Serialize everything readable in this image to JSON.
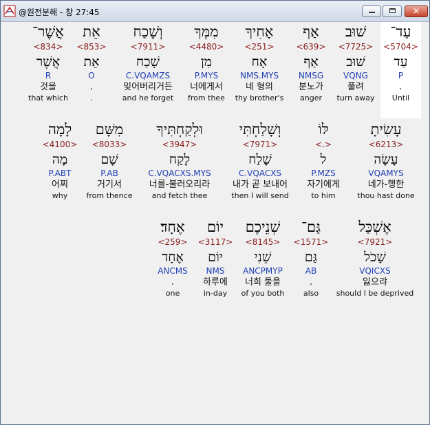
{
  "window": {
    "title": "@원전분해 - 창 27:45"
  },
  "rows": [
    [
      {
        "heb": "עַד־",
        "strong": "<5704>",
        "root": "עַד",
        "morph": "P",
        "kor": ".",
        "eng": "Until",
        "selected": true
      },
      {
        "heb": "שׁוּב",
        "strong": "<7725>",
        "root": "שׁוּב",
        "morph": "VQNG",
        "kor": "풀려",
        "eng": "turn away"
      },
      {
        "heb": "אַף",
        "strong": "<639>",
        "root": "אַף",
        "morph": "NMSG",
        "kor": "분노가",
        "eng": "anger"
      },
      {
        "heb": "אָחִיךָ",
        "strong": "<251>",
        "root": "אָח",
        "morph": "NMS.MYS",
        "kor": "네 형의",
        "eng": "thy brother's"
      },
      {
        "heb": "מִמְּךָ",
        "strong": "<4480>",
        "root": "מִן",
        "morph": "P.MYS",
        "kor": "너에게서",
        "eng": "from thee"
      },
      {
        "heb": "וְשָׁכַח",
        "strong": "<7911>",
        "root": "שָׁכַח",
        "morph": "C.VQAMZS",
        "kor": "잊어버리거든",
        "eng": "and he forget"
      },
      {
        "heb": "אֵת",
        "strong": "<853>",
        "root": "אֵת",
        "morph": "O",
        "kor": ".",
        "eng": "."
      },
      {
        "heb": "אֲשֶׁר־",
        "strong": "<834>",
        "root": "אֲשֶׁר",
        "morph": "R",
        "kor": "것을",
        "eng": "that which"
      }
    ],
    [
      {
        "heb": "עָשִׂיתָ",
        "strong": "<6213>",
        "root": "עָשָׂה",
        "morph": "VQAMYS",
        "kor": "네가-행한",
        "eng": "thou hast done"
      },
      {
        "heb": "לּוֹ",
        "strong": "<.>",
        "root": "ל",
        "morph": "P.MZS",
        "kor": "자기에게",
        "eng": "to him"
      },
      {
        "heb": "וְשָׁלַחְתִּי",
        "strong": "<7971>",
        "root": "שָׁלַח",
        "morph": "C.VQACXS",
        "kor": "내가 곧 보내어",
        "eng": "then I will send"
      },
      {
        "heb": "וּלְקַחְתִּיךָ",
        "strong": "<3947>",
        "root": "לָקַח",
        "morph": "C.VQACXS.MYS",
        "kor": "너를-불러오리라",
        "eng": "and fetch thee"
      },
      {
        "heb": "מִשָּׁם",
        "strong": "<8033>",
        "root": "שָׁם",
        "morph": "P.AB",
        "kor": "거기서",
        "eng": "from thence"
      },
      {
        "heb": "לָמָה",
        "strong": "<4100>",
        "root": "מָה",
        "morph": "P.ABT",
        "kor": "어찌",
        "eng": "why"
      }
    ],
    [
      {
        "heb": "אֶשְׁכַּל",
        "strong": "<7921>",
        "root": "שָׁכֹל",
        "morph": "VQICXS",
        "kor": "잃으랴",
        "eng": "should I be deprived"
      },
      {
        "heb": "גַּם־",
        "strong": "<1571>",
        "root": "גַּם",
        "morph": "AB",
        "kor": ".",
        "eng": "also"
      },
      {
        "heb": "שְׁנֵיכֶם",
        "strong": "<8145>",
        "root": "שֵׁנִי",
        "morph": "ANCPMYP",
        "kor": "너희 둘을",
        "eng": "of you both"
      },
      {
        "heb": "יוֹם",
        "strong": "<3117>",
        "root": "יוֹם",
        "morph": "NMS",
        "kor": "하루에",
        "eng": "in-day"
      },
      {
        "heb": "אֶחָד׃",
        "strong": "<259>",
        "root": "אֶחָד",
        "morph": "ANCMS",
        "kor": ".",
        "eng": "one"
      }
    ]
  ]
}
